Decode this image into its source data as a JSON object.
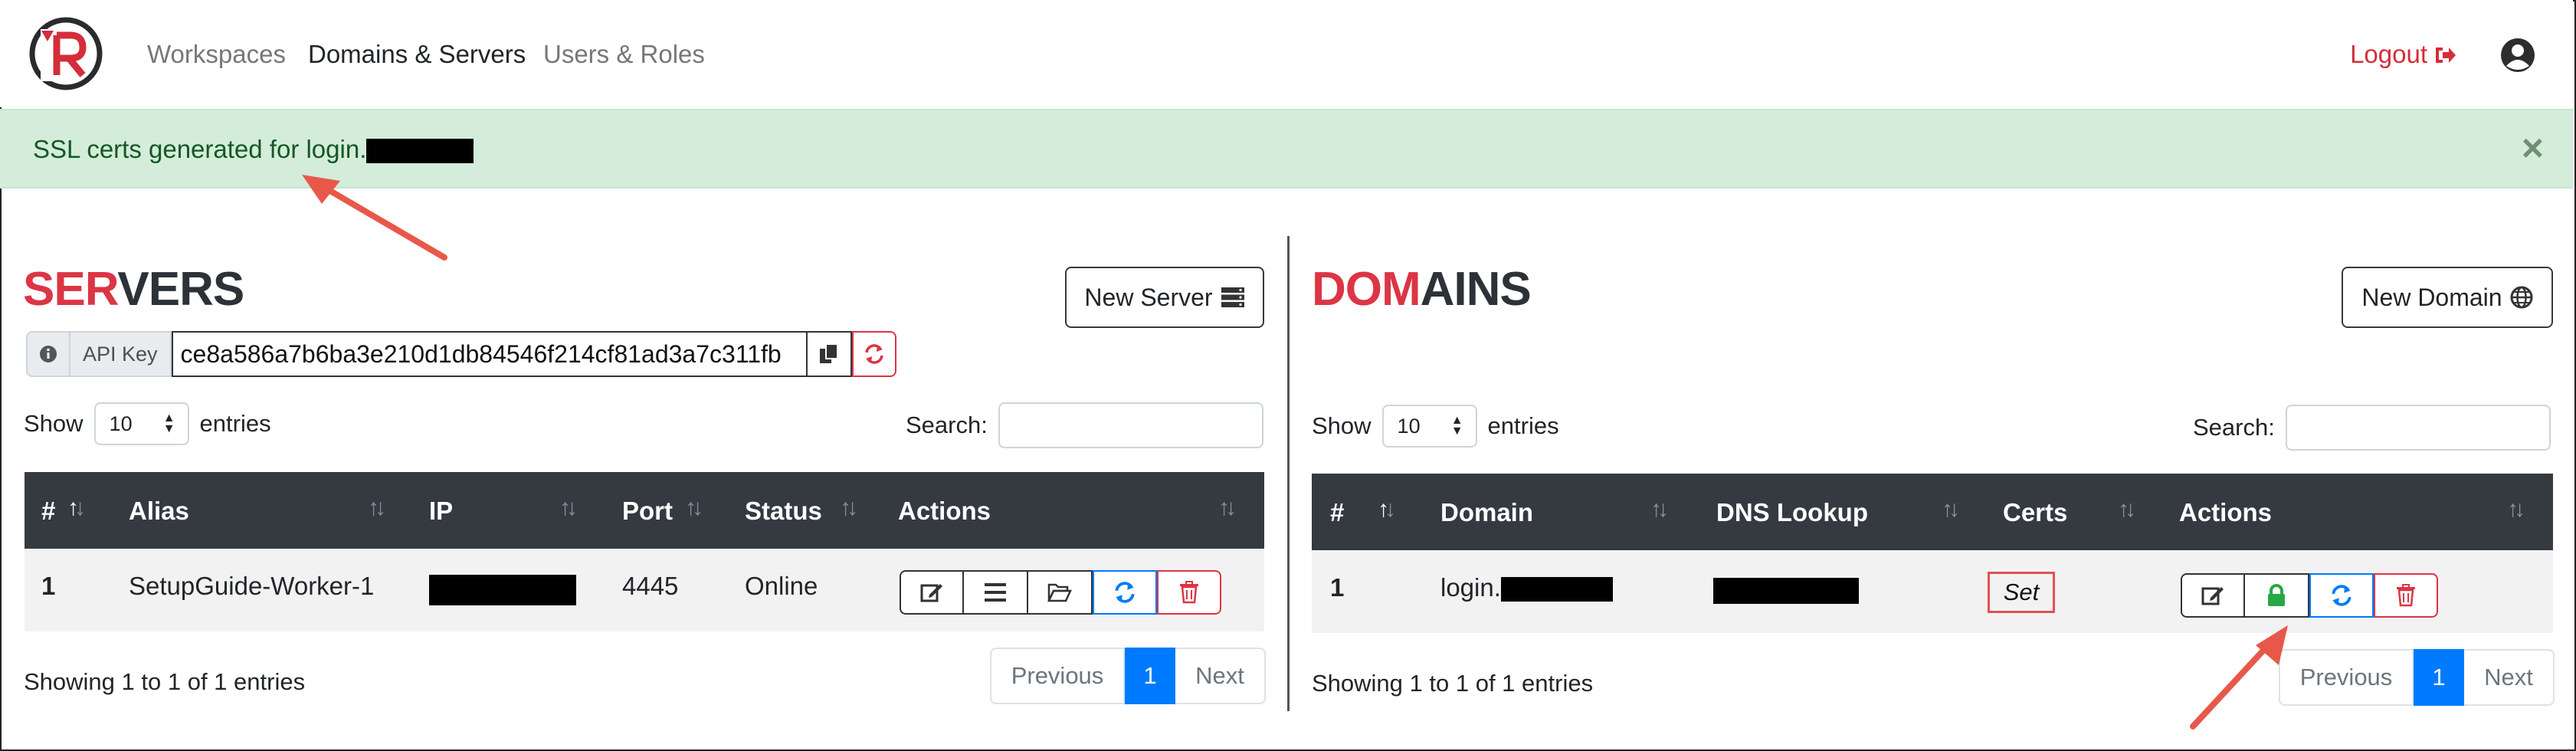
{
  "nav": {
    "links": [
      "Workspaces",
      "Domains & Servers",
      "Users & Roles"
    ],
    "logout": "Logout"
  },
  "alert": {
    "text": "SSL certs generated for login."
  },
  "servers": {
    "title_red": "SER",
    "title_dark": "VERS",
    "new_button": "New Server",
    "api_key_label": "API Key",
    "api_key_value": "ce8a586a7b6ba3e210d1db84546f214cf81ad3a7c311fb",
    "show_label": "Show",
    "entries_label": "entries",
    "page_size": "10",
    "search_label": "Search:",
    "columns": [
      "#",
      "Alias",
      "IP",
      "Port",
      "Status",
      "Actions"
    ],
    "rows": [
      {
        "num": "1",
        "alias": "SetupGuide-Worker-1",
        "port": "4445",
        "status": "Online"
      }
    ],
    "info": "Showing 1 to 1 of 1 entries",
    "pager": {
      "prev": "Previous",
      "current": "1",
      "next": "Next"
    }
  },
  "domains": {
    "title_red": "DOM",
    "title_dark": "AINS",
    "new_button": "New Domain",
    "show_label": "Show",
    "entries_label": "entries",
    "page_size": "10",
    "search_label": "Search:",
    "columns": [
      "#",
      "Domain",
      "DNS Lookup",
      "Certs",
      "Actions"
    ],
    "rows": [
      {
        "num": "1",
        "domain": "login.",
        "certs": "Set"
      }
    ],
    "info": "Showing 1 to 1 of 1 entries",
    "pager": {
      "prev": "Previous",
      "current": "1",
      "next": "Next"
    }
  },
  "colors": {
    "brand_red": "#dc3545",
    "alert_bg": "#d4edda",
    "header_dark": "#343a40",
    "link_blue": "#007bff",
    "annotation": "#e8584a"
  }
}
